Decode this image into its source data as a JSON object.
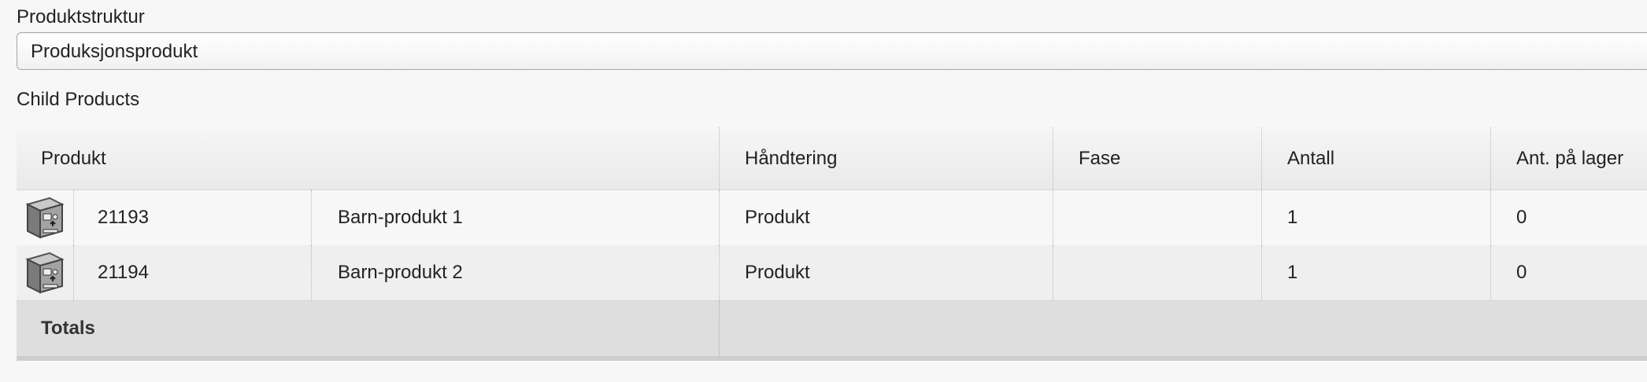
{
  "form": {
    "structure_label": "Produktstruktur",
    "structure_value": "Produksjonsprodukt",
    "section_title": "Child Products"
  },
  "grid": {
    "columns": [
      "Produkt",
      "Håndtering",
      "Fase",
      "Antall",
      "Ant. på lager"
    ],
    "rows": [
      {
        "icon": "product-box-icon",
        "code": "21193",
        "name": "Barn-produkt 1",
        "handling": "Produkt",
        "phase": "",
        "quantity": "1",
        "in_stock": "0"
      },
      {
        "icon": "product-box-icon",
        "code": "21194",
        "name": "Barn-produkt 2",
        "handling": "Produkt",
        "phase": "",
        "quantity": "1",
        "in_stock": "0"
      }
    ],
    "totals_label": "Totals"
  }
}
